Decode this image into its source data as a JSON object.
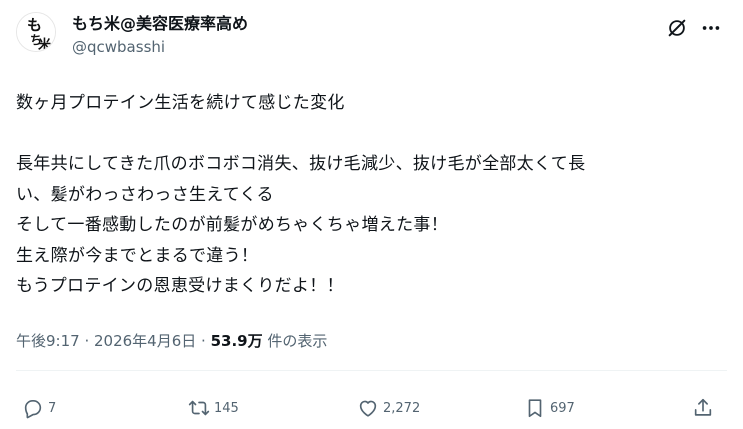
{
  "author": {
    "display_name": "もち米@美容医療率高め",
    "handle": "@qcwbasshi",
    "avatar_text": "もち米"
  },
  "post": {
    "lines": [
      "数ヶ月プロテイン生活を続けて感じた変化",
      "",
      "長年共にしてきた爪のボコボコ消失、抜け毛減少、抜け毛が全部太くて長",
      "い、髪がわっさわっさ生えてくる",
      "そして一番感動したのが前髪がめちゃくちゃ増えた事！",
      "生え際が今までとまるで違う！",
      "もうプロテインの恩恵受けまくりだよ！！"
    ]
  },
  "meta": {
    "time": "午後9:17",
    "separator": " · ",
    "date": "2026年4月6日",
    "views": "53.9万",
    "views_label": " 件の表示"
  },
  "actions": {
    "replies": "7",
    "reposts": "145",
    "likes": "2,272",
    "bookmarks": "697"
  },
  "icons": [
    "grok-icon",
    "more-icon",
    "reply-icon",
    "repost-icon",
    "like-icon",
    "bookmark-icon",
    "share-icon"
  ]
}
